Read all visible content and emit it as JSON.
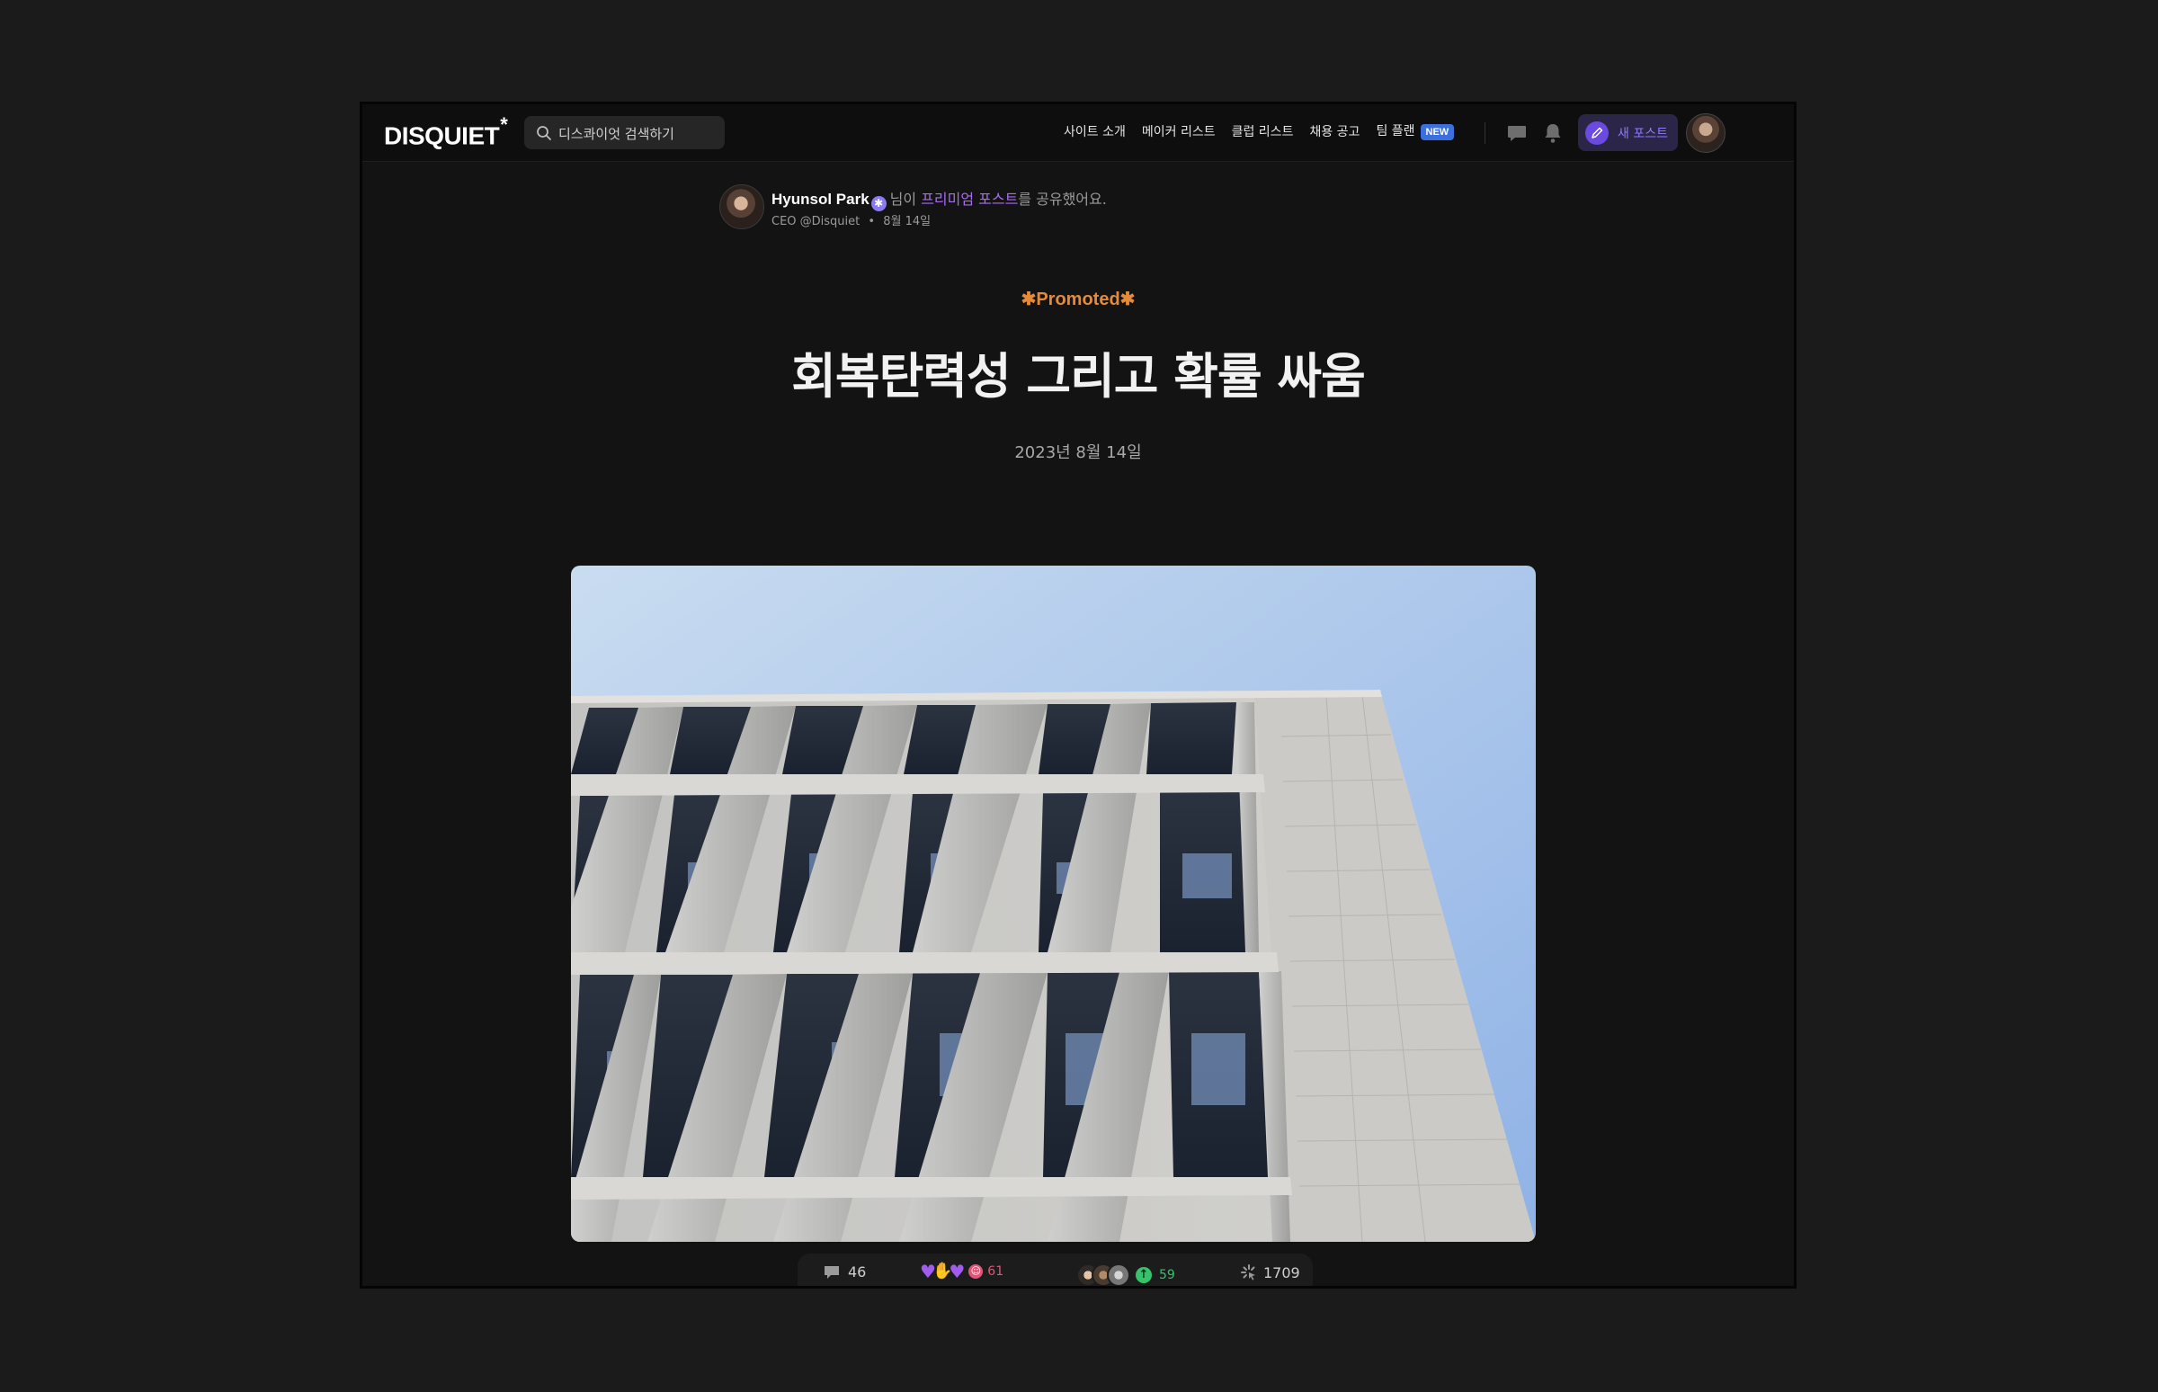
{
  "nav": {
    "logo": "DISQUIET",
    "logo_mark": "*",
    "search_placeholder": "디스콰이엇 검색하기",
    "links": [
      "사이트 소개",
      "메이커 리스트",
      "클럽 리스트",
      "채용 공고",
      "팀 플랜"
    ],
    "new_badge": "NEW",
    "new_post_label": "새 포스트"
  },
  "post": {
    "author_name": "Hyunsol Park",
    "shared_prefix": "님이 ",
    "premium_text": "프리미엄 포스트",
    "shared_suffix": "를 공유했어요.",
    "author_role": "CEO @Disquiet",
    "separator": "•",
    "shared_date": "8월 14일",
    "promoted_label": "✱Promoted✱",
    "title": "회복탄력성 그리고 확률 싸움",
    "published_date": "2023년 8월 14일",
    "hero_image": "building-facade-photo"
  },
  "stats": {
    "comments": "46",
    "reactions": "61",
    "upvotes": "59",
    "views": "1709"
  },
  "colors": {
    "accent_purple": "#8f7bff",
    "premium": "#a76cf3",
    "promoted": "#e48a3a",
    "upvote_green": "#35c46b",
    "reaction_pink": "#e0567a",
    "new_badge_blue": "#3b6fe0"
  }
}
